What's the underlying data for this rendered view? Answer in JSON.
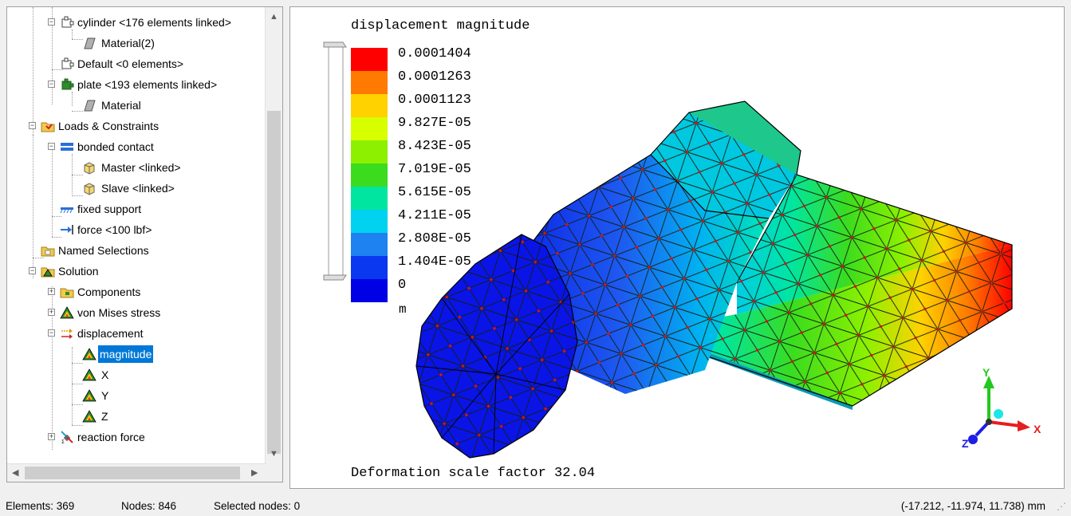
{
  "tree": {
    "items": [
      {
        "label": "cylinder <176 elements linked>",
        "icon": "body-puzzle-icon"
      },
      {
        "label": "Material(2)",
        "icon": "material-icon"
      },
      {
        "label": "Default <0 elements>",
        "icon": "body-puzzle-icon"
      },
      {
        "label": "plate <193 elements linked>",
        "icon": "body-puzzle-icon"
      },
      {
        "label": "Material",
        "icon": "material-icon"
      },
      {
        "label": "Loads & Constraints",
        "icon": "folder-loads-icon"
      },
      {
        "label": "bonded contact",
        "icon": "contact-icon"
      },
      {
        "label": "Master <linked>",
        "icon": "cube-icon"
      },
      {
        "label": "Slave <linked>",
        "icon": "cube-icon"
      },
      {
        "label": "fixed support",
        "icon": "fixed-support-icon"
      },
      {
        "label": "force <100 lbf>",
        "icon": "force-icon"
      },
      {
        "label": "Named Selections",
        "icon": "named-selection-icon"
      },
      {
        "label": "Solution",
        "icon": "solution-icon"
      },
      {
        "label": "Components",
        "icon": "folder-icon"
      },
      {
        "label": "von Mises stress",
        "icon": "result-icon"
      },
      {
        "label": "displacement",
        "icon": "displacement-icon"
      },
      {
        "label": "magnitude",
        "icon": "result-icon"
      },
      {
        "label": "X",
        "icon": "result-icon"
      },
      {
        "label": "Y",
        "icon": "result-icon"
      },
      {
        "label": "Z",
        "icon": "result-icon"
      },
      {
        "label": "reaction force",
        "icon": "reaction-force-icon"
      }
    ],
    "selected": "magnitude"
  },
  "viewport": {
    "title": "displacement magnitude",
    "unit": "m",
    "footer": "Deformation scale factor 32.04",
    "legend": [
      {
        "value": "0.0001404",
        "color": "#ff0000"
      },
      {
        "value": "0.0001263",
        "color": "#ff7a00"
      },
      {
        "value": "0.0001123",
        "color": "#ffd200"
      },
      {
        "value": "9.827E-05",
        "color": "#d7ff00"
      },
      {
        "value": "8.423E-05",
        "color": "#8cf000"
      },
      {
        "value": "7.019E-05",
        "color": "#3bdc1e"
      },
      {
        "value": "5.615E-05",
        "color": "#00e6a0"
      },
      {
        "value": "4.211E-05",
        "color": "#00d2f0"
      },
      {
        "value": "2.808E-05",
        "color": "#1e82f0"
      },
      {
        "value": "1.404E-05",
        "color": "#0a37f0"
      },
      {
        "value": "0",
        "color": "#0000e6"
      }
    ],
    "axes": {
      "x": "X",
      "y": "Y",
      "z": "Z"
    }
  },
  "status": {
    "elements": "Elements: 369",
    "nodes": "Nodes: 846",
    "selected_nodes": "Selected nodes: 0",
    "coords": "(-17.212, -11.974, 11.738) mm"
  }
}
